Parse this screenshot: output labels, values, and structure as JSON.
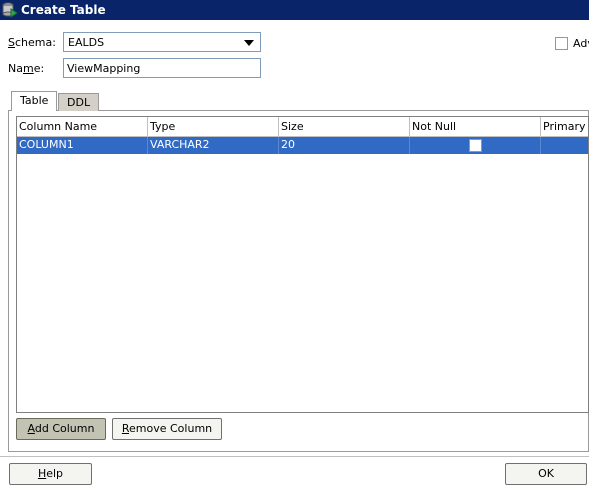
{
  "window": {
    "title": "Create Table"
  },
  "form": {
    "schema_label_u": "S",
    "schema_label_rest": "chema:",
    "schema_value": "EALDS",
    "name_label_pre": "Na",
    "name_label_u": "m",
    "name_label_post": "e:",
    "name_value": "ViewMapping",
    "advanced_label": "Adv"
  },
  "tabs": [
    {
      "label": "Table",
      "active": true
    },
    {
      "label": "DDL",
      "active": false
    }
  ],
  "table": {
    "headers": [
      "Column Name",
      "Type",
      "Size",
      "Not Null",
      "Primary Ke"
    ],
    "rows": [
      {
        "name": "COLUMN1",
        "type": "VARCHAR2",
        "size": "20",
        "not_null": false,
        "primary_key": false,
        "selected": true
      }
    ]
  },
  "buttons": {
    "add_column_u": "A",
    "add_column_rest": "dd Column",
    "remove_column_u": "R",
    "remove_column_rest": "emove Column",
    "help_u": "H",
    "help_rest": "elp",
    "ok": "OK"
  },
  "colors": {
    "titlebar": "#0a246a",
    "selection": "#316ac5"
  },
  "icons": {
    "app": "database-table-icon",
    "combo_arrow": "chevron-down-icon"
  }
}
